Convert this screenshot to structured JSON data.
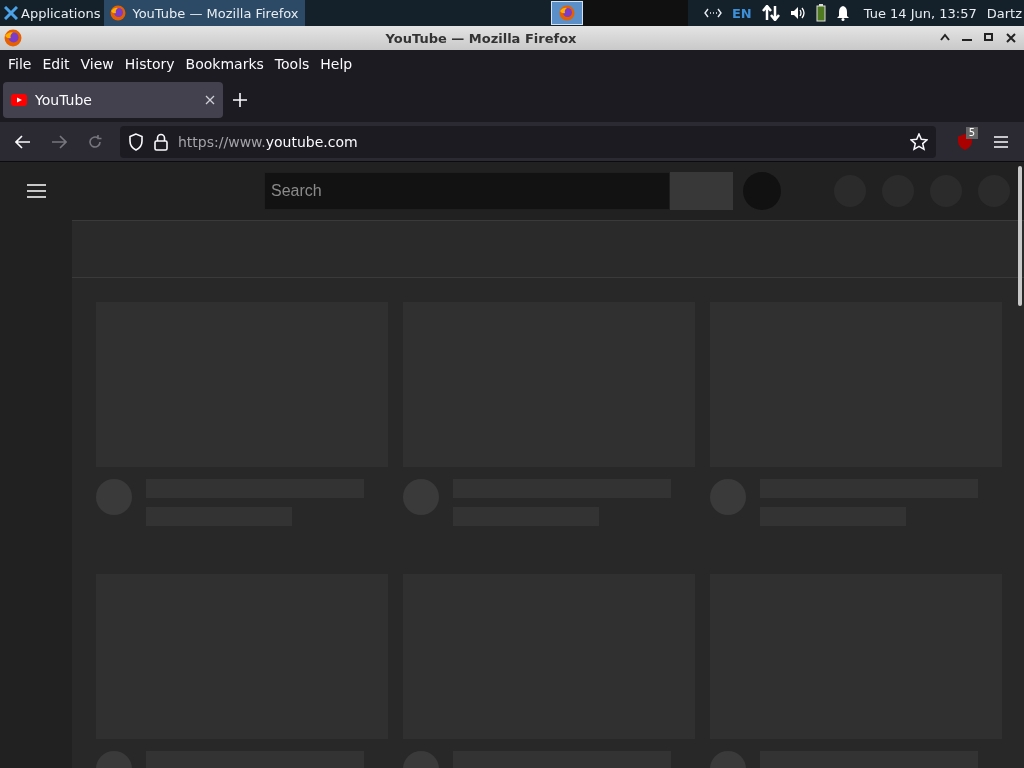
{
  "taskbar": {
    "apps_label": "Applications",
    "tasks": [
      {
        "label": "YouTube — Mozilla Firefox",
        "selected": true
      }
    ],
    "language": "EN",
    "clock": "Tue 14 Jun, 13:57",
    "user": "Dartz"
  },
  "window": {
    "title": "YouTube — Mozilla Firefox"
  },
  "menu": [
    {
      "label": "File"
    },
    {
      "label": "Edit"
    },
    {
      "label": "View"
    },
    {
      "label": "History"
    },
    {
      "label": "Bookmarks"
    },
    {
      "label": "Tools"
    },
    {
      "label": "Help"
    }
  ],
  "tabs": [
    {
      "label": "YouTube",
      "selected": true
    }
  ],
  "navigation": {
    "back_disabled": false,
    "forward_disabled": true
  },
  "address_bar": {
    "url_prefix": "https://www.",
    "url_domain": "youtube.com"
  },
  "extension_badge": "5",
  "page": {
    "search": {
      "placeholder": "Search"
    }
  }
}
